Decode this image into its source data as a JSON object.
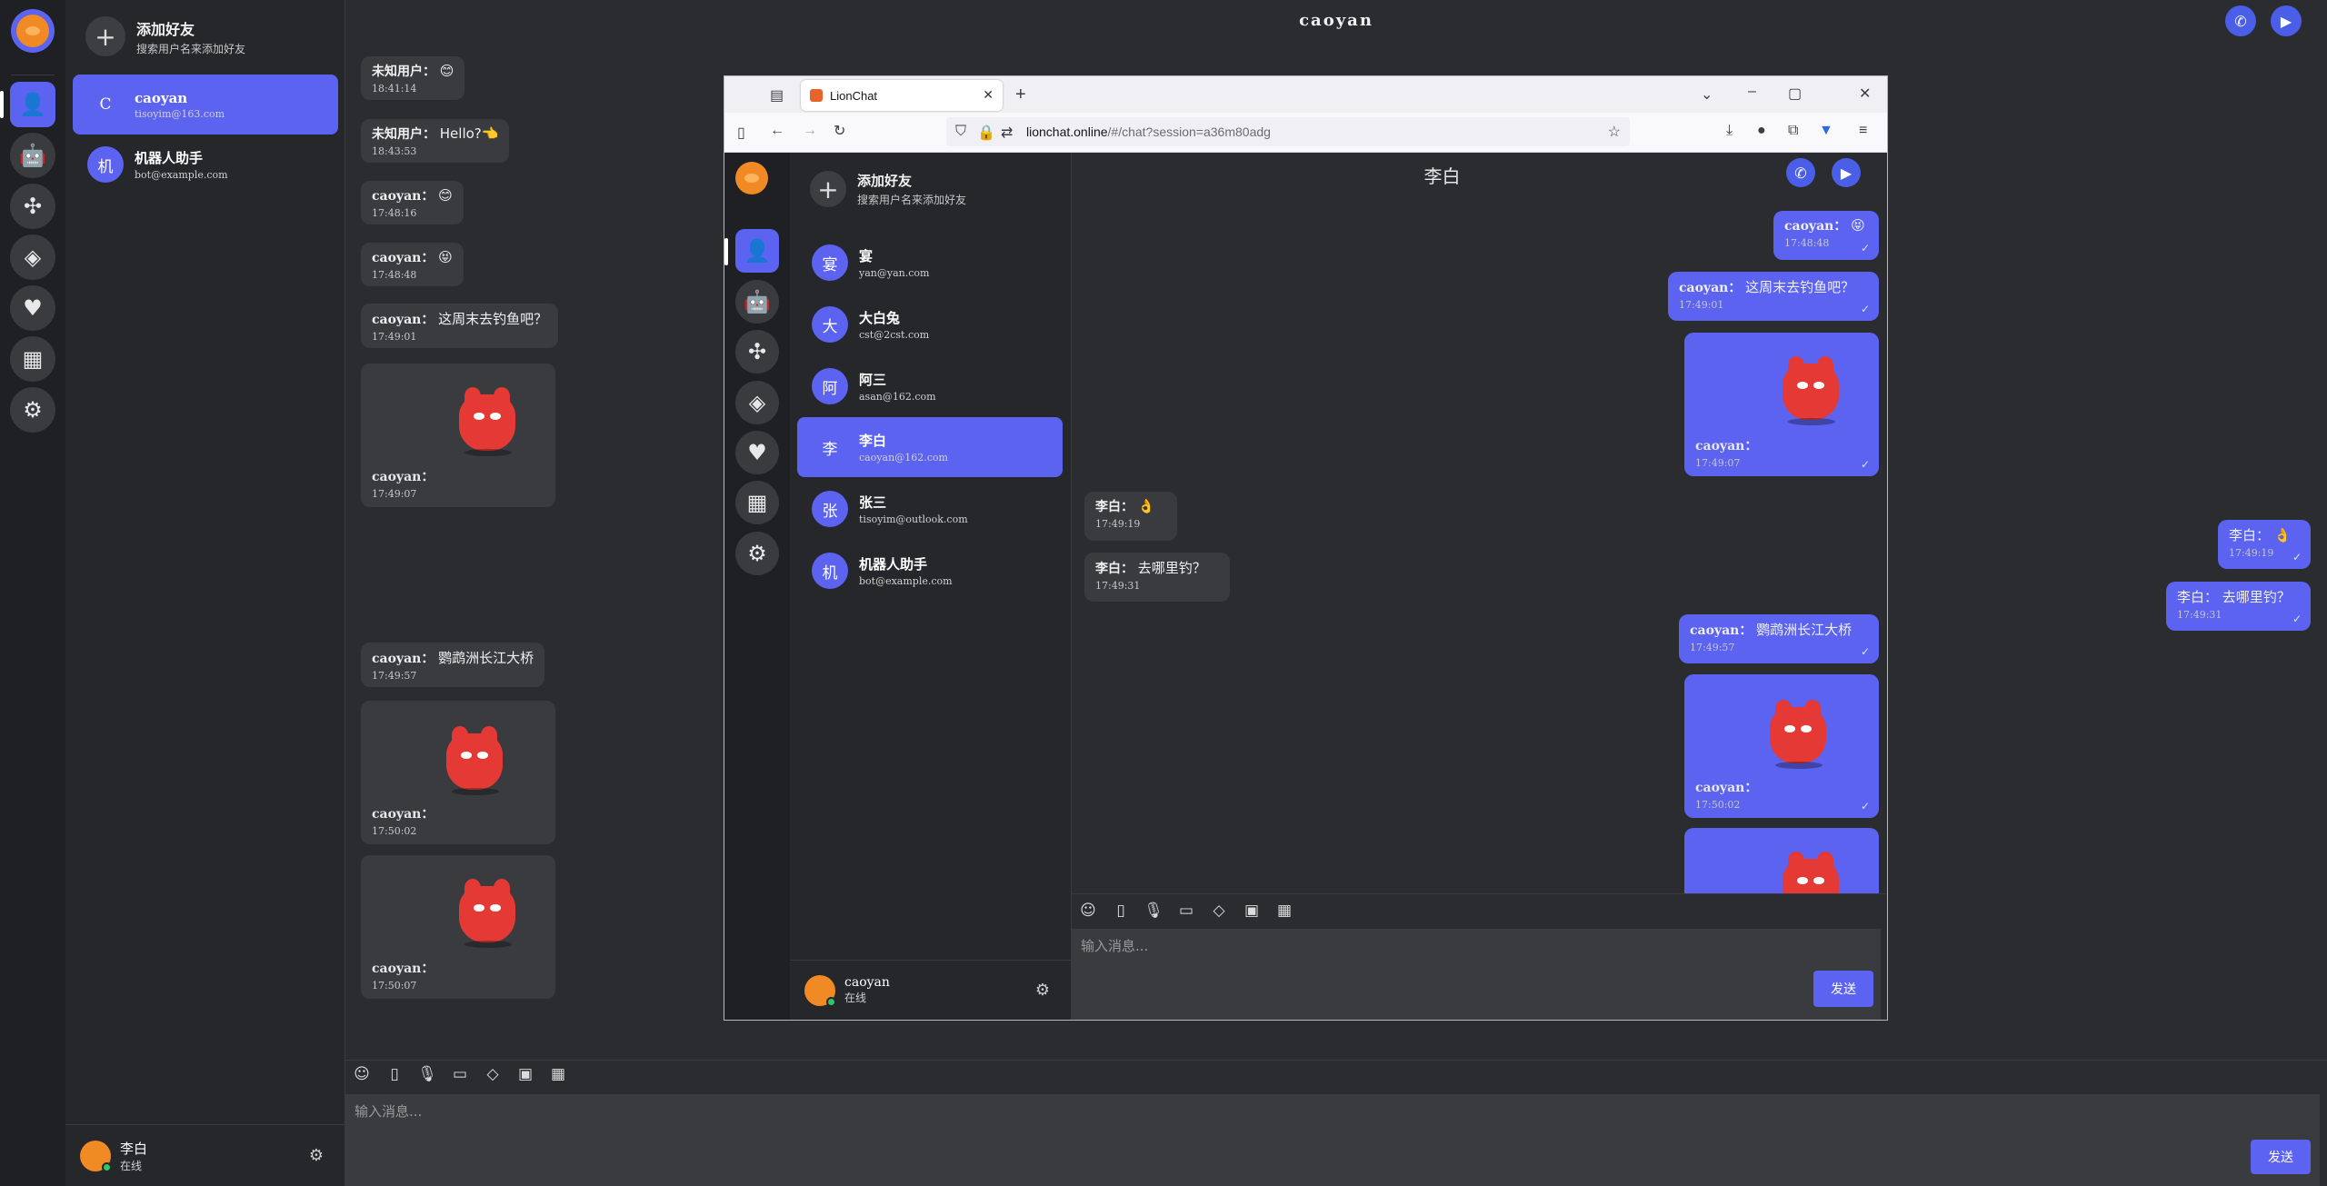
{
  "outer": {
    "title": "caoyan",
    "add_friend": {
      "title": "添加好友",
      "subtitle": "搜索用户名来添加好友",
      "icon": "plus-icon"
    },
    "contacts": [
      {
        "initial": "C",
        "name": "caoyan",
        "email": "tisoyim@163.com",
        "active": true
      },
      {
        "initial": "机",
        "name": "机器人助手",
        "email": "bot@example.com",
        "active": false
      }
    ],
    "self": {
      "name": "李白",
      "status": "在线"
    },
    "messages": [
      {
        "sender": "未知用户：",
        "text": "😊",
        "time": "18:41:14"
      },
      {
        "sender": "未知用户：",
        "text": "Hello?👈",
        "time": "18:43:53"
      },
      {
        "sender": "caoyan：",
        "text": "😊",
        "time": "17:48:16"
      },
      {
        "sender": "caoyan：",
        "text": "😝",
        "time": "17:48:48"
      },
      {
        "sender": "caoyan：",
        "text": "这周末去钓鱼吧？",
        "time": "17:49:01"
      },
      {
        "sender": "caoyan：",
        "text": "",
        "time": "17:49:07"
      },
      {
        "sender": "caoyan：",
        "text": "鹦鹉洲长江大桥",
        "time": "17:49:57"
      },
      {
        "sender": "caoyan：",
        "text": "",
        "time": "17:50:02"
      },
      {
        "sender": "caoyan：",
        "text": "",
        "time": "17:50:07"
      }
    ],
    "mine": [
      {
        "sender": "李白：",
        "text": "👌",
        "time": "17:49:19",
        "check": "✓"
      },
      {
        "sender": "李白：",
        "text": "去哪里钓？",
        "time": "17:49:31",
        "check": "✓"
      }
    ],
    "input_placeholder": "输入消息...",
    "send_label": "发送"
  },
  "browser": {
    "tab_title": "LionChat",
    "url_host": "lionchat.online",
    "url_path": "/#/chat?session=a36m80adg"
  },
  "inner": {
    "title": "李白",
    "add_friend": {
      "title": "添加好友",
      "subtitle": "搜索用户名来添加好友"
    },
    "contacts": [
      {
        "initial": "宴",
        "name": "宴",
        "email": "yan@yan.com",
        "active": false
      },
      {
        "initial": "大",
        "name": "大白兔",
        "email": "cst@2cst.com",
        "active": false
      },
      {
        "initial": "阿",
        "name": "阿三",
        "email": "asan@162.com",
        "active": false
      },
      {
        "initial": "李",
        "name": "李白",
        "email": "caoyan@162.com",
        "active": true
      },
      {
        "initial": "张",
        "name": "张三",
        "email": "tisoyim@outlook.com",
        "active": false
      },
      {
        "initial": "机",
        "name": "机器人助手",
        "email": "bot@example.com",
        "active": false
      }
    ],
    "self": {
      "name": "caoyan",
      "status": "在线"
    },
    "mine": [
      {
        "sender": "caoyan：",
        "text": "😝",
        "time": "17:48:48",
        "check": "✓"
      },
      {
        "sender": "caoyan：",
        "text": "这周末去钓鱼吧？",
        "time": "17:49:01",
        "check": "✓"
      },
      {
        "sender": "caoyan：",
        "text": "",
        "time": "17:49:07",
        "check": "✓"
      },
      {
        "sender": "caoyan：",
        "text": "鹦鹉洲长江大桥",
        "time": "17:49:57",
        "check": "✓"
      },
      {
        "sender": "caoyan：",
        "text": "",
        "time": "17:50:02",
        "check": "✓"
      }
    ],
    "theirs": [
      {
        "sender": "李白：",
        "text": "👌",
        "time": "17:49:19"
      },
      {
        "sender": "李白：",
        "text": "去哪里钓？",
        "time": "17:49:31"
      }
    ],
    "input_placeholder": "输入消息...",
    "send_label": "发送"
  },
  "colors": {
    "accent": "#5b63f0",
    "bg": "#2b2c2f",
    "panel": "#26272a",
    "rail": "#1f2023",
    "bubble": "#3a3b3f",
    "sticker": "#e53935"
  },
  "icons": [
    "lion-logo-icon",
    "user-icon",
    "robot-icon",
    "pinwheel-icon",
    "compass-icon",
    "heart-icon",
    "calendar-icon",
    "gear-icon",
    "phone-icon",
    "video-icon",
    "emoji-icon",
    "file-icon",
    "mic-icon",
    "card-icon",
    "tag-icon",
    "image-icon"
  ]
}
